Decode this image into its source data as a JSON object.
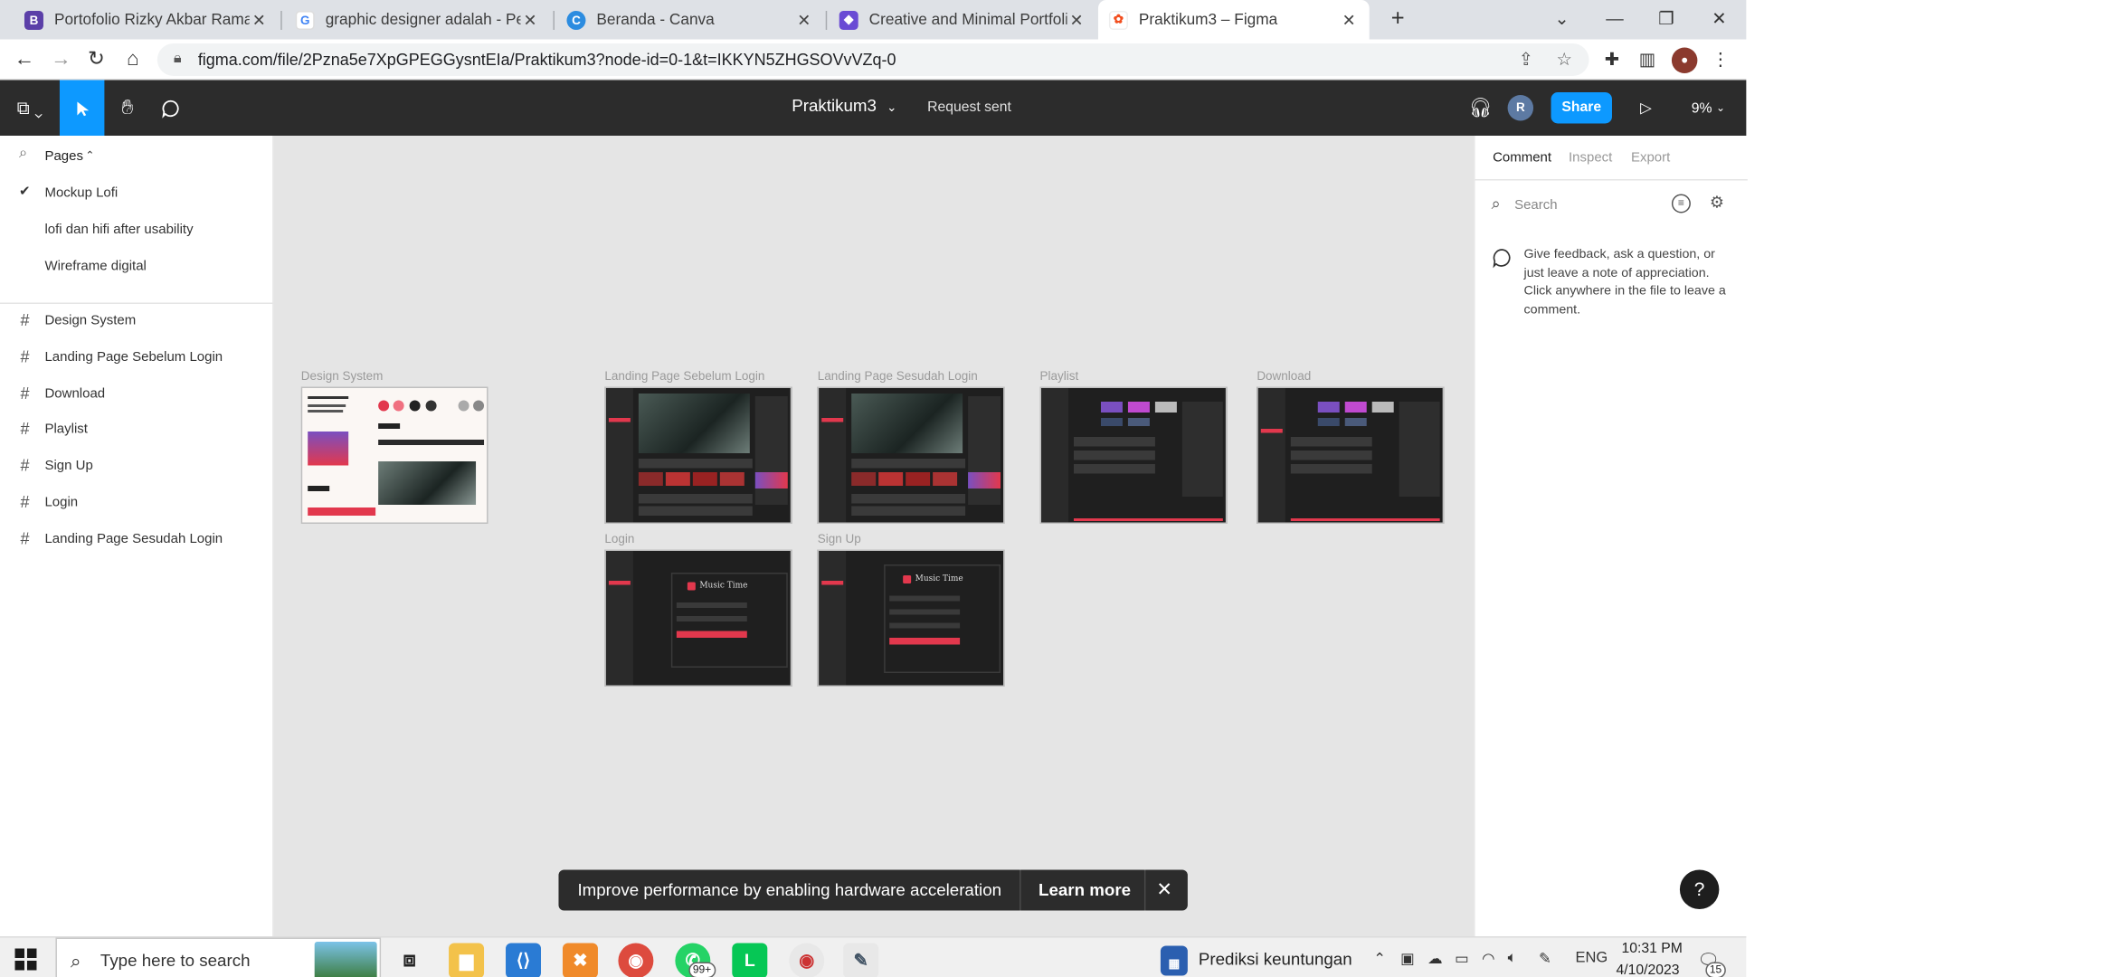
{
  "browser": {
    "tabs": [
      {
        "label": "Portofolio Rizky Akbar Ramadhan",
        "icon": "behance-icon",
        "color": "#5b3fa8"
      },
      {
        "label": "graphic designer adalah - Penelusuran Google",
        "icon": "google-icon",
        "color": "#4285f4"
      },
      {
        "label": "Beranda - Canva",
        "icon": "canva-icon",
        "color": "#2c8ce0"
      },
      {
        "label": "Creative and Minimal Portfolio Presentation",
        "icon": "canva-design-icon",
        "color": "#6a4bd4"
      },
      {
        "label": "Praktikum3 – Figma",
        "icon": "figma-icon",
        "color": "#f24e1e"
      }
    ],
    "url": "figma.com/file/2Pzna5e7XpGPEGGysntEIa/Praktikum3?node-id=0-1&t=IKKYN5ZHGSOVvVZq-0",
    "new_tab": "+",
    "window_controls": {
      "dropdown": "⌄",
      "minimize": "—",
      "restore": "❐",
      "close": "✕"
    }
  },
  "figma": {
    "file_title": "Praktikum3",
    "status": "Request sent",
    "avatar_initial": "R",
    "share_label": "Share",
    "zoom": "9%",
    "accent_color": "#0d99ff"
  },
  "left_panel": {
    "pages_label": "Pages",
    "pages": [
      {
        "label": "Mockup Lofi",
        "selected": true
      },
      {
        "label": "lofi dan hifi after usability",
        "selected": false
      },
      {
        "label": "Wireframe digital",
        "selected": false
      }
    ],
    "layers": [
      "Design System",
      "Landing Page Sebelum Login",
      "Download",
      "Playlist",
      "Sign Up",
      "Login",
      "Landing Page Sesudah Login"
    ]
  },
  "canvas": {
    "frames": [
      {
        "label": "Design System"
      },
      {
        "label": "Landing Page Sebelum Login"
      },
      {
        "label": "Landing Page Sesudah Login"
      },
      {
        "label": "Playlist"
      },
      {
        "label": "Download"
      },
      {
        "label": "Login",
        "brand": "Music Time"
      },
      {
        "label": "Sign Up",
        "brand": "Music Time"
      }
    ]
  },
  "right_panel": {
    "tabs": [
      "Comment",
      "Inspect",
      "Export"
    ],
    "search_placeholder": "Search",
    "help_text": "Give feedback, ask a question, or just leave a note of appreciation. Click anywhere in the file to leave a comment.",
    "help_button": "?"
  },
  "toast": {
    "message": "Improve performance by enabling hardware acceleration",
    "learn_more": "Learn more",
    "close": "✕"
  },
  "taskbar": {
    "search_placeholder": "Type here to search",
    "whatsapp_badge": "99+",
    "widget_label": "Prediksi keuntungan",
    "language": "ENG",
    "time": "10:31 PM",
    "date": "4/10/2023",
    "notifications": "15"
  }
}
